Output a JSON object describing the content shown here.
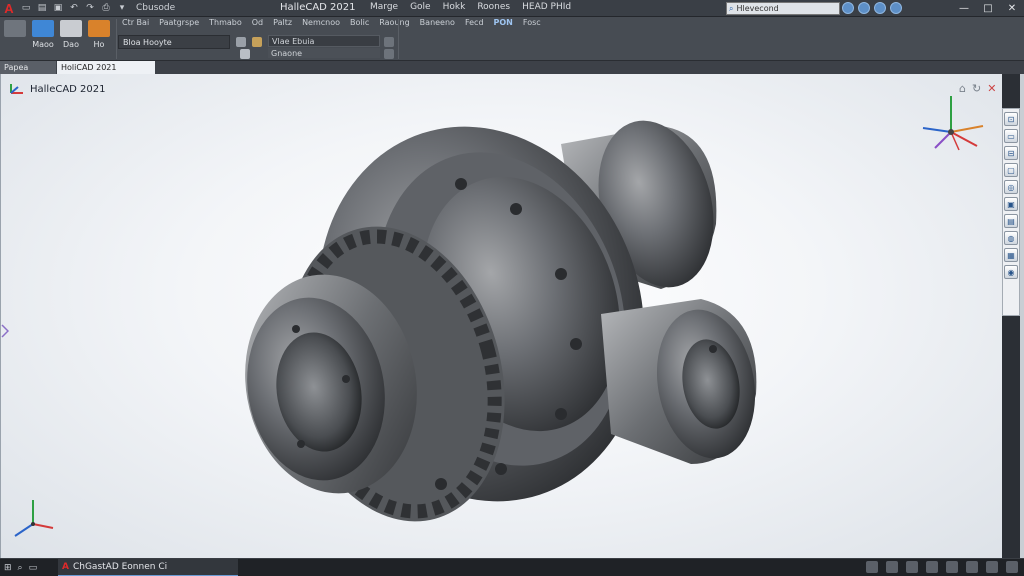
{
  "titlebar": {
    "logo": "A",
    "qa_label": "Cbusode",
    "title": "HalleCAD 2021",
    "menus": [
      "Marge",
      "Gole",
      "Hokk",
      "Roones",
      "HEAD PHId"
    ],
    "search_value": "Hlevecond",
    "minimize": "—",
    "maximize": "□",
    "close": "✕"
  },
  "ribbon": {
    "tools": [
      {
        "label": "",
        "color": "#6f757d"
      },
      {
        "label": "Maoo",
        "color": "#3f87d6"
      },
      {
        "label": "Dao",
        "color": "#c9ccd1"
      },
      {
        "label": "Ho",
        "color": "#d9822b"
      }
    ],
    "row1_items": [
      "Ctr Bai",
      "Paatgrspe",
      "Thmabo",
      "Od",
      "Paltz",
      "Nemcnoo",
      "Bolic",
      "Raoung",
      "Baneeno",
      "Fecd",
      "PON",
      "Fosc"
    ],
    "sub_label": "Bloa   Hooyte",
    "field1": "Vlae Ebuia",
    "field2": "Gnaone"
  },
  "tabs": {
    "inactive": "Papea",
    "active": "HoliCAD 2021"
  },
  "viewport": {
    "label": "HalleCAD 2021"
  },
  "sidebar": {
    "buttons": [
      "⊡",
      "▭",
      "⊟",
      "▢",
      "◎",
      "▣",
      "▤",
      "◍",
      "▦",
      "◉"
    ]
  },
  "taskbar": {
    "start": "⊞",
    "app_label": "ChGastAD Eonnen Ci",
    "tray_count": 8
  },
  "colors": {
    "accent": "#3f87d6",
    "axis_x": "#d43a3a",
    "axis_y": "#2ea043",
    "axis_z": "#2b64c9"
  }
}
